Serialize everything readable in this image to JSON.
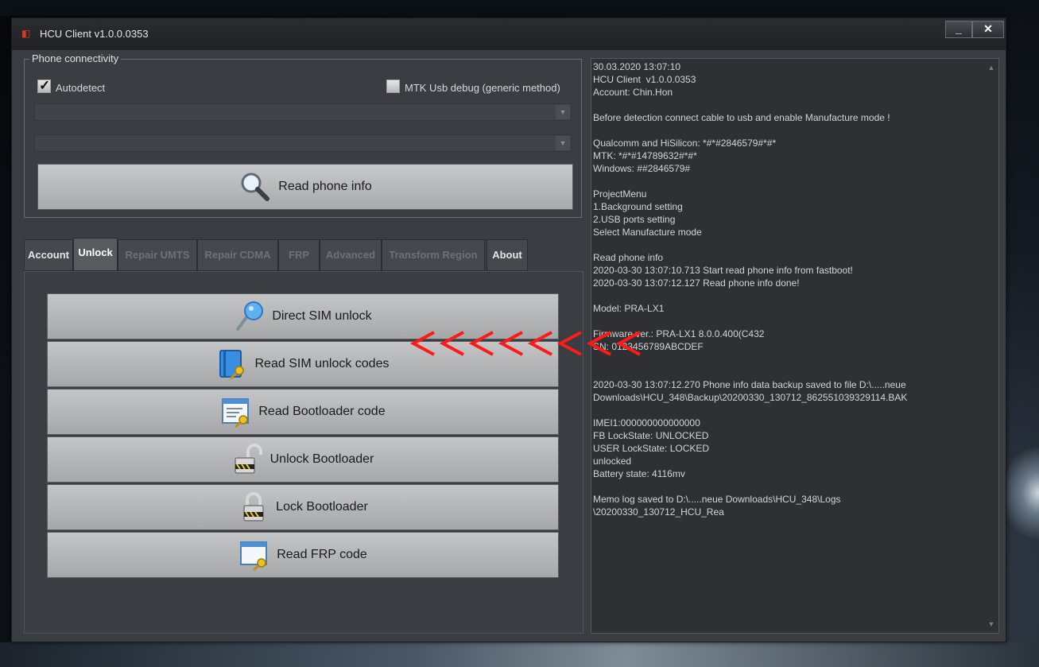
{
  "window": {
    "title": "HCU Client  v1.0.0.0353",
    "minimize_glyph": "_",
    "close_glyph": "✕"
  },
  "connectivity": {
    "group_title": "Phone connectivity",
    "autodetect_label": "Autodetect",
    "autodetect_checked": true,
    "mtk_label": "MTK Usb debug (generic method)",
    "mtk_checked": false,
    "port_combo_value": "",
    "model_combo_value": "",
    "read_button_label": "Read phone info",
    "read_button_icon": "magnifier-icon"
  },
  "tabs": [
    {
      "label": "Account",
      "enabled": true
    },
    {
      "label": "Unlock",
      "enabled": true,
      "active": true
    },
    {
      "label": "Repair UMTS",
      "enabled": false
    },
    {
      "label": "Repair CDMA",
      "enabled": false
    },
    {
      "label": "FRP",
      "enabled": false
    },
    {
      "label": "Advanced",
      "enabled": false
    },
    {
      "label": "Transform Region",
      "enabled": false
    },
    {
      "label": "About",
      "enabled": true
    }
  ],
  "unlock": {
    "buttons": [
      {
        "label": "Direct SIM unlock",
        "icon": "key-icon"
      },
      {
        "label": "Read SIM unlock codes",
        "icon": "book-key-icon"
      },
      {
        "label": "Read Bootloader code",
        "icon": "document-key-icon"
      },
      {
        "label": "Unlock Bootloader",
        "icon": "padlock-open-icon"
      },
      {
        "label": "Lock Bootloader",
        "icon": "padlock-closed-icon"
      },
      {
        "label": "Read FRP code",
        "icon": "window-key-icon"
      }
    ]
  },
  "annotation": {
    "arrow_color": "#ff1a1a",
    "count": 8
  },
  "log": {
    "lines": [
      "30.03.2020 13:07:10",
      "HCU Client  v1.0.0.0353",
      "Account: Chin.Hon",
      "",
      "Before detection connect cable to usb and enable Manufacture mode !",
      "",
      "Qualcomm and HiSilicon: *#*#2846579#*#*",
      "MTK: *#*#14789632#*#*",
      "Windows: ##2846579#",
      "",
      "ProjectMenu",
      "1.Background setting",
      "2.USB ports setting",
      "Select Manufacture mode",
      "",
      "Read phone info",
      "2020-03-30 13:07:10.713 Start read phone info from fastboot!",
      "2020-03-30 13:07:12.127 Read phone info done!",
      "",
      "Model: PRA-LX1",
      "",
      "Firmware ver.: PRA-LX1 8.0.0.400(C432",
      "SN: 0123456789ABCDEF",
      "",
      "",
      "2020-03-30 13:07:12.270 Phone info data backup saved to file D:\\.....neue",
      "Downloads\\HCU_348\\Backup\\20200330_130712_862551039329114.BAK",
      "",
      "IMEI1:000000000000000",
      "FB LockState: UNLOCKED",
      "USER LockState: LOCKED",
      "unlocked",
      "Battery state: 4116mv",
      "",
      "Memo log saved to D:\\.....neue Downloads\\HCU_348\\Logs",
      "\\20200330_130712_HCU_Rea"
    ]
  }
}
